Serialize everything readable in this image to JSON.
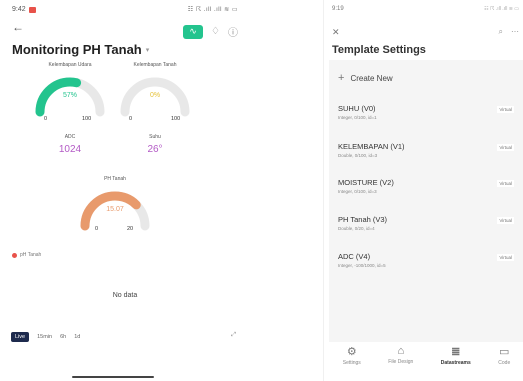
{
  "left": {
    "status": {
      "time": "9:42",
      "icons": "☷ ☈ .ıll .ıll ≋ ▭"
    },
    "title": "Monitoring PH Tanah",
    "gauges": [
      {
        "label": "Kelembapan Udara",
        "value": "57%",
        "min": "0",
        "max": "100",
        "level": 0.57,
        "color": "#23c48e",
        "value_color": "#23c48e"
      },
      {
        "label": "Kelembapan Tanah",
        "value": "0%",
        "min": "0",
        "max": "100",
        "level": 0.0,
        "color": "#e8e8e8",
        "value_color": "#e6c23a"
      },
      {
        "label": "PH Tanah",
        "value": "15.07",
        "min": "0",
        "max": "20",
        "level": 0.75,
        "color": "#e89a6c",
        "value_color": "#e89a6c"
      }
    ],
    "values": [
      {
        "label": "ADC",
        "value": "1024"
      },
      {
        "label": "Suhu",
        "value": "26°"
      }
    ],
    "legend": "pH Tanah",
    "no_data": "No data",
    "time_tabs": [
      "Live",
      "15min",
      "6h",
      "1d"
    ],
    "active_tab": "Live",
    "expand_icon": "expand-icon",
    "icons": [
      "back-arrow-icon",
      "pulse-icon",
      "bell-icon",
      "info-icon"
    ]
  },
  "right": {
    "status": {
      "time": "9:19",
      "icons": "☷ ☈ .ıll .ıll ≋ ▭"
    },
    "title": "Template Settings",
    "create_new": "Create New",
    "datastreams": [
      {
        "name": "SUHU (V0)",
        "desc": "Integer, 0/100, id=1",
        "tag": "Virtual"
      },
      {
        "name": "KELEMBAPAN (V1)",
        "desc": "Double, 0/100, id=3",
        "tag": "Virtual"
      },
      {
        "name": "MOISTURE (V2)",
        "desc": "Integer, 0/100, id=3",
        "tag": "Virtual"
      },
      {
        "name": "PH Tanah (V3)",
        "desc": "Double, 0/20, id=4",
        "tag": "Virtual"
      },
      {
        "name": "ADC (V4)",
        "desc": "Integer, -100/1000, id=5",
        "tag": "Virtual"
      }
    ],
    "nav": [
      {
        "label": "Settings",
        "icon": "gear-icon"
      },
      {
        "label": "File Design",
        "icon": "design-icon"
      },
      {
        "label": "Datastreams",
        "icon": "datastreams-icon",
        "active": true
      },
      {
        "label": "Code",
        "icon": "code-icon"
      }
    ]
  }
}
